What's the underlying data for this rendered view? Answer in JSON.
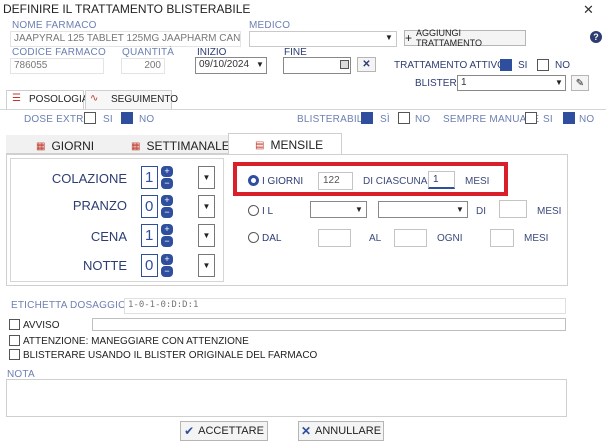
{
  "window": {
    "title": "DEFINIRE IL TRATTAMENTO BLISTERABILE",
    "close_glyph": "✕"
  },
  "farmaco": {
    "label": "NOME FARMACO",
    "value": "JAAPYRAL 125 TABLET 125MG JAAPHARM CANADA INC."
  },
  "medico": {
    "label": "MEDICO",
    "value": "",
    "add_label": "AGGIUNGI TRATTAMENTO",
    "help_glyph": "?"
  },
  "codice": {
    "label": "CODICE FARMACO",
    "value": "786055"
  },
  "quantita": {
    "label": "QUANTITÀ",
    "value": "200"
  },
  "inizio": {
    "label": "INIZIO",
    "value": "09/10/2024"
  },
  "fine": {
    "label": "FINE",
    "value": ""
  },
  "trattamento_attivo": {
    "label": "TRATTAMENTO ATTIVO",
    "si": "SI",
    "no": "NO"
  },
  "blister": {
    "label": "BLISTER:",
    "value": "1"
  },
  "main_tabs": [
    {
      "label": "POSOLOGIA"
    },
    {
      "label": "SEGUIMENTO"
    }
  ],
  "dose_extra": {
    "label": "DOSE EXTRA",
    "si": "SI",
    "no": "NO"
  },
  "blisterabile": {
    "label": "BLISTERABILE",
    "si": "SÌ",
    "no": "NO"
  },
  "sempre_manuale": {
    "label": "SEMPRE MANUALE",
    "si": "SI",
    "no": "NO"
  },
  "freq_tabs": [
    {
      "label": "GIORNI"
    },
    {
      "label": "SETTIMANALE"
    },
    {
      "label": "MENSILE"
    }
  ],
  "meals": [
    {
      "label": "COLAZIONE",
      "value": "1"
    },
    {
      "label": "PRANZO",
      "value": "0"
    },
    {
      "label": "CENA",
      "value": "1"
    },
    {
      "label": "NOTTE",
      "value": "0"
    }
  ],
  "mensile": {
    "opt1": {
      "label": "I GIORNI",
      "days": "122",
      "di_ciascuna": "DI CIASCUNA",
      "months": "1",
      "mesi": "MESI"
    },
    "opt2": {
      "label": "I L",
      "di": "DI",
      "mesi": "MESI"
    },
    "opt3": {
      "label": "DAL",
      "al": "AL",
      "ogni": "OGNI",
      "mesi": "MESI"
    }
  },
  "etichetta": {
    "label": "ETICHETTA DOSAGGIO",
    "value": "1-0-1-0:D:D:1"
  },
  "avviso": {
    "label": "AVVISO"
  },
  "attenzione": {
    "label": "ATTENZIONE: MANEGGIARE CON ATTENZIONE"
  },
  "blister_originale": {
    "label": "BLISTERARE USANDO IL BLISTER ORIGINALE DEL FARMACO"
  },
  "nota": {
    "label": "NOTA"
  },
  "actions": {
    "accept": "ACCETTARE",
    "cancel": "ANNULLARE"
  },
  "colors": {
    "accent": "#2f4f9e",
    "highlight": "#d9202a",
    "label": "#6b7fb3"
  }
}
